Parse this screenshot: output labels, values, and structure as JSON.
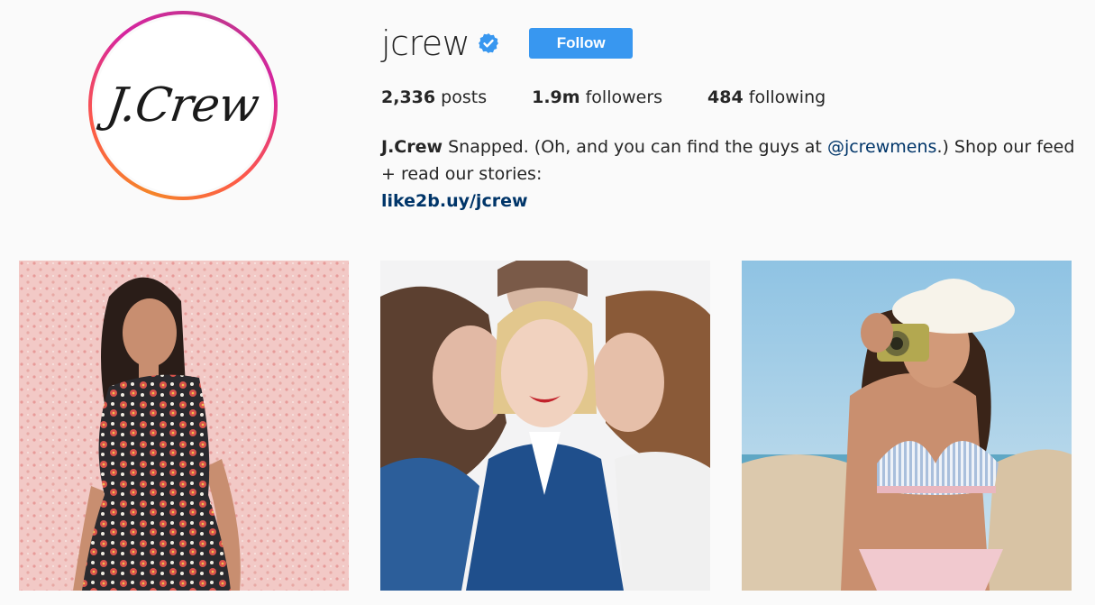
{
  "profile": {
    "avatar_logo": "J.Crew",
    "username": "jcrew",
    "verified_icon": "verified-badge-icon",
    "follow_label": "Follow",
    "stats": {
      "posts_value": "2,336",
      "posts_label": "posts",
      "followers_value": "1.9m",
      "followers_label": "followers",
      "following_value": "484",
      "following_label": "following"
    },
    "bio": {
      "name": "J.Crew",
      "text_before_mention": " Snapped. (Oh, and you can find the guys at ",
      "mention": "@jcrewmens",
      "text_after_mention": ".) Shop our feed + read our stories:",
      "link": "like2b.uy/jcrew"
    }
  },
  "posts": [
    {
      "name": "post-floral-dress",
      "alt": "Woman in floral dress against pink patterned wall"
    },
    {
      "name": "post-three-kiss",
      "alt": "Woman in denim jacket kissed on the cheeks by two men"
    },
    {
      "name": "post-bikini-camera",
      "alt": "Woman in bikini and bucket hat holding a camera on the beach"
    }
  ],
  "colors": {
    "follow_button": "#3897f0",
    "link": "#003569",
    "verified": "#3897f0",
    "background": "#fafafa"
  }
}
